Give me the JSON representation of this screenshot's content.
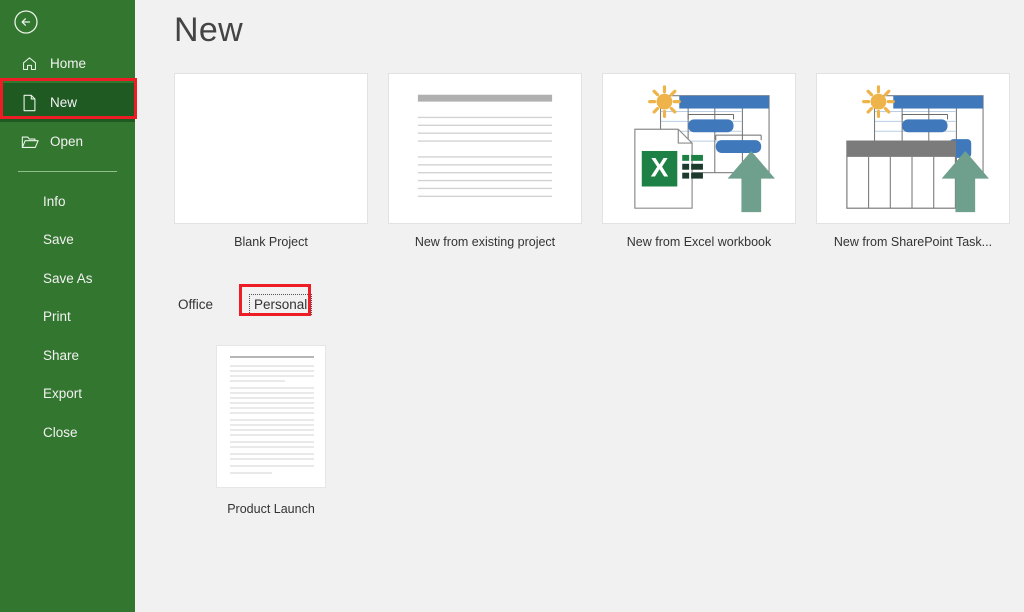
{
  "app": {
    "backstage_title": "New",
    "accent_green": "#33762f",
    "accent_green_active": "#205a23",
    "annotation_red": "#ee1c24",
    "content_bg": "#f1f1f1"
  },
  "sidebar": {
    "back_button": {
      "name": "back-arrow",
      "label": "Back"
    },
    "primary_items": [
      {
        "label": "Home",
        "icon": "home-icon",
        "active": false
      },
      {
        "label": "New",
        "icon": "new-document-icon",
        "active": true
      },
      {
        "label": "Open",
        "icon": "open-folder-icon",
        "active": false
      }
    ],
    "secondary_items": [
      {
        "label": "Info"
      },
      {
        "label": "Save"
      },
      {
        "label": "Save As"
      },
      {
        "label": "Print"
      },
      {
        "label": "Share"
      },
      {
        "label": "Export"
      },
      {
        "label": "Close"
      }
    ]
  },
  "main": {
    "title": "New",
    "featured_templates": [
      {
        "label": "Blank Project",
        "art": "blank"
      },
      {
        "label": "New from existing project",
        "art": "lines"
      },
      {
        "label": "New from Excel workbook",
        "art": "excel"
      },
      {
        "label": "New from SharePoint Task...",
        "art": "sharepoint"
      }
    ],
    "tabs": [
      {
        "label": "Office",
        "selected": false
      },
      {
        "label": "Personal",
        "selected": true
      }
    ],
    "personal_templates": [
      {
        "label": "Product Launch"
      }
    ]
  },
  "annotations": [
    {
      "target": "sidebar-item-new",
      "color": "#ee1c24"
    },
    {
      "target": "tab-personal",
      "color": "#ee1c24"
    }
  ]
}
